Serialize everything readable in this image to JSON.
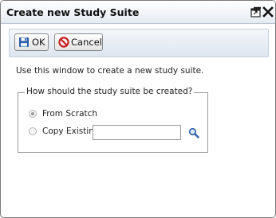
{
  "window": {
    "title": "Create new Study Suite",
    "restore_icon": "restore-window-icon",
    "close_icon": "close-icon"
  },
  "toolbar": {
    "ok_label": "OK",
    "ok_icon": "save-disk-icon",
    "cancel_label": "Cancel",
    "cancel_icon": "cancel-circle-icon"
  },
  "intro": {
    "text": "Use this window to create a new study suite."
  },
  "creation": {
    "legend": "How should the study suite be created?",
    "options": [
      {
        "label": "From Scratch",
        "selected": true
      },
      {
        "label": "Copy Existing",
        "selected": false
      }
    ],
    "copy_value": "",
    "search_icon": "search-icon"
  },
  "colors": {
    "titlebar_bottom": "#e6ebf2",
    "toolbar_bottom": "#dde5ef",
    "cancel_red": "#cc2222",
    "save_blue": "#2a5da8"
  }
}
